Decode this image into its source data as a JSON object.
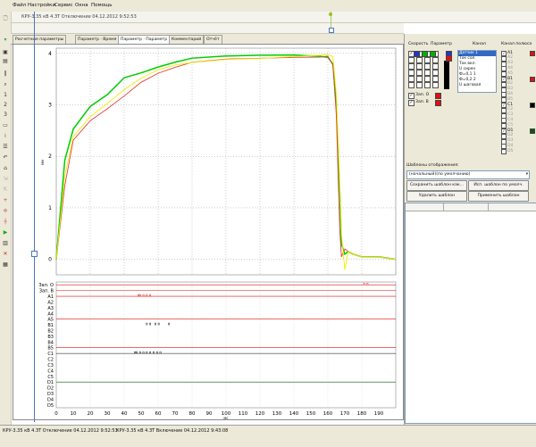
{
  "menu": {
    "file": "Файл",
    "settings": "Настройки",
    "service": "Сервис",
    "windows": "Окна",
    "help": "Помощь"
  },
  "window": {
    "title": "КРУ-3.35 кВ 4.ЗТ Отключение 04.12.2012 9:52:53"
  },
  "tabs": [
    "Расчетные параметры",
    "Параметр · Время",
    "Параметр · Параметр",
    "Комментарий",
    "Отчёт"
  ],
  "active_tab_index": 2,
  "analog_chart": {
    "y_ticks": [
      "4",
      "3",
      "2",
      "1",
      "0"
    ],
    "y_unit": "мм"
  },
  "discrete_chart": {
    "channels": [
      "Зап. О",
      "Зап. В",
      "А1",
      "А2",
      "А3",
      "А4",
      "А5",
      "В1",
      "В2",
      "В3",
      "В4",
      "В5",
      "С1",
      "С2",
      "С3",
      "С4",
      "С5",
      "D1",
      "D2",
      "D3",
      "D4",
      "D5"
    ],
    "x_ticks": [
      "0",
      "10",
      "20",
      "30",
      "40",
      "50",
      "60",
      "70",
      "80",
      "90",
      "100",
      "110",
      "120",
      "130",
      "140",
      "150",
      "160",
      "170",
      "180",
      "190"
    ],
    "x_unit": "мс"
  },
  "chart_data": {
    "type": "line",
    "x": [
      0,
      5,
      10,
      20,
      30,
      40,
      50,
      60,
      70,
      80,
      100,
      120,
      140,
      155,
      160,
      163,
      165,
      167,
      168,
      170,
      172,
      175,
      180,
      185,
      190,
      200
    ],
    "series": [
      {
        "color": "#00cc00",
        "values": [
          0,
          1.9,
          2.5,
          2.95,
          3.2,
          3.55,
          3.65,
          3.75,
          3.82,
          3.88,
          3.92,
          3.95,
          3.98,
          3.97,
          3.95,
          3.8,
          3.0,
          1.3,
          0.3,
          0.1,
          0.15,
          0.1,
          0.05,
          0.05,
          0.05,
          0.0
        ]
      },
      {
        "color": "#e04040",
        "values": [
          0,
          1.4,
          2.3,
          2.7,
          2.95,
          3.2,
          3.45,
          3.6,
          3.7,
          3.8,
          3.88,
          3.92,
          3.95,
          3.95,
          3.95,
          3.75,
          2.8,
          0.6,
          0.05,
          0.2,
          0.15,
          0.1,
          0.05,
          0.05,
          0.05,
          0.0
        ]
      },
      {
        "color": "#eeee00",
        "values": [
          0,
          1.6,
          2.4,
          2.8,
          3.05,
          3.3,
          3.5,
          3.65,
          3.75,
          3.82,
          3.9,
          3.93,
          3.96,
          3.96,
          3.96,
          3.9,
          3.2,
          1.5,
          0.5,
          -0.2,
          0.15,
          0.1,
          0.05,
          0.05,
          0.05,
          0.0
        ]
      }
    ],
    "ylim": [
      -0.3,
      4.1
    ],
    "xlim": [
      0,
      200
    ]
  },
  "right_panel": {
    "speed_header": "Скорость",
    "param_header": "Параметр",
    "channel_header": "Канал",
    "channel_items": [
      "Датчик 1",
      "Ток сол.",
      "Ток вкл.",
      "U сирен",
      "Ф=0,1 1",
      "Ф=0,2 2",
      "U шаговая"
    ],
    "selected_channel": "Датчик 1",
    "zap_o": "Зап. О",
    "zap_v": "Зап. В",
    "polarity_header": "Канал полюса",
    "polarity_items": [
      "А1",
      "А2",
      "А3",
      "А4",
      "А5",
      "В1",
      "В2",
      "В3",
      "В4",
      "В5",
      "С1",
      "С2",
      "С3",
      "С4",
      "С5",
      "D1",
      "D2",
      "D3",
      "D4",
      "D5"
    ],
    "templates_label": "Шаблоны отображения:",
    "template_value": "(начальный)(по умолчанию)",
    "save_btn": "Сохранить шаблон как...",
    "use_default_btn": "Исп. шаблон по умолч.",
    "delete_btn": "Удалить шаблон",
    "apply_btn": "Применить шаблон",
    "colors": {
      "blue": "#1f39c8",
      "green": "#00b000",
      "red": "#e01010",
      "black": "#000000",
      "dark_green": "#0a5a0a"
    }
  },
  "status": {
    "left": "КРУ-3.35 кВ 4.ЗТ Отключение 04.12.2012 9:52:53",
    "right": "КРУ-3.35 кВ 4.ЗТ Включение 04.12.2012 9:43:08"
  }
}
